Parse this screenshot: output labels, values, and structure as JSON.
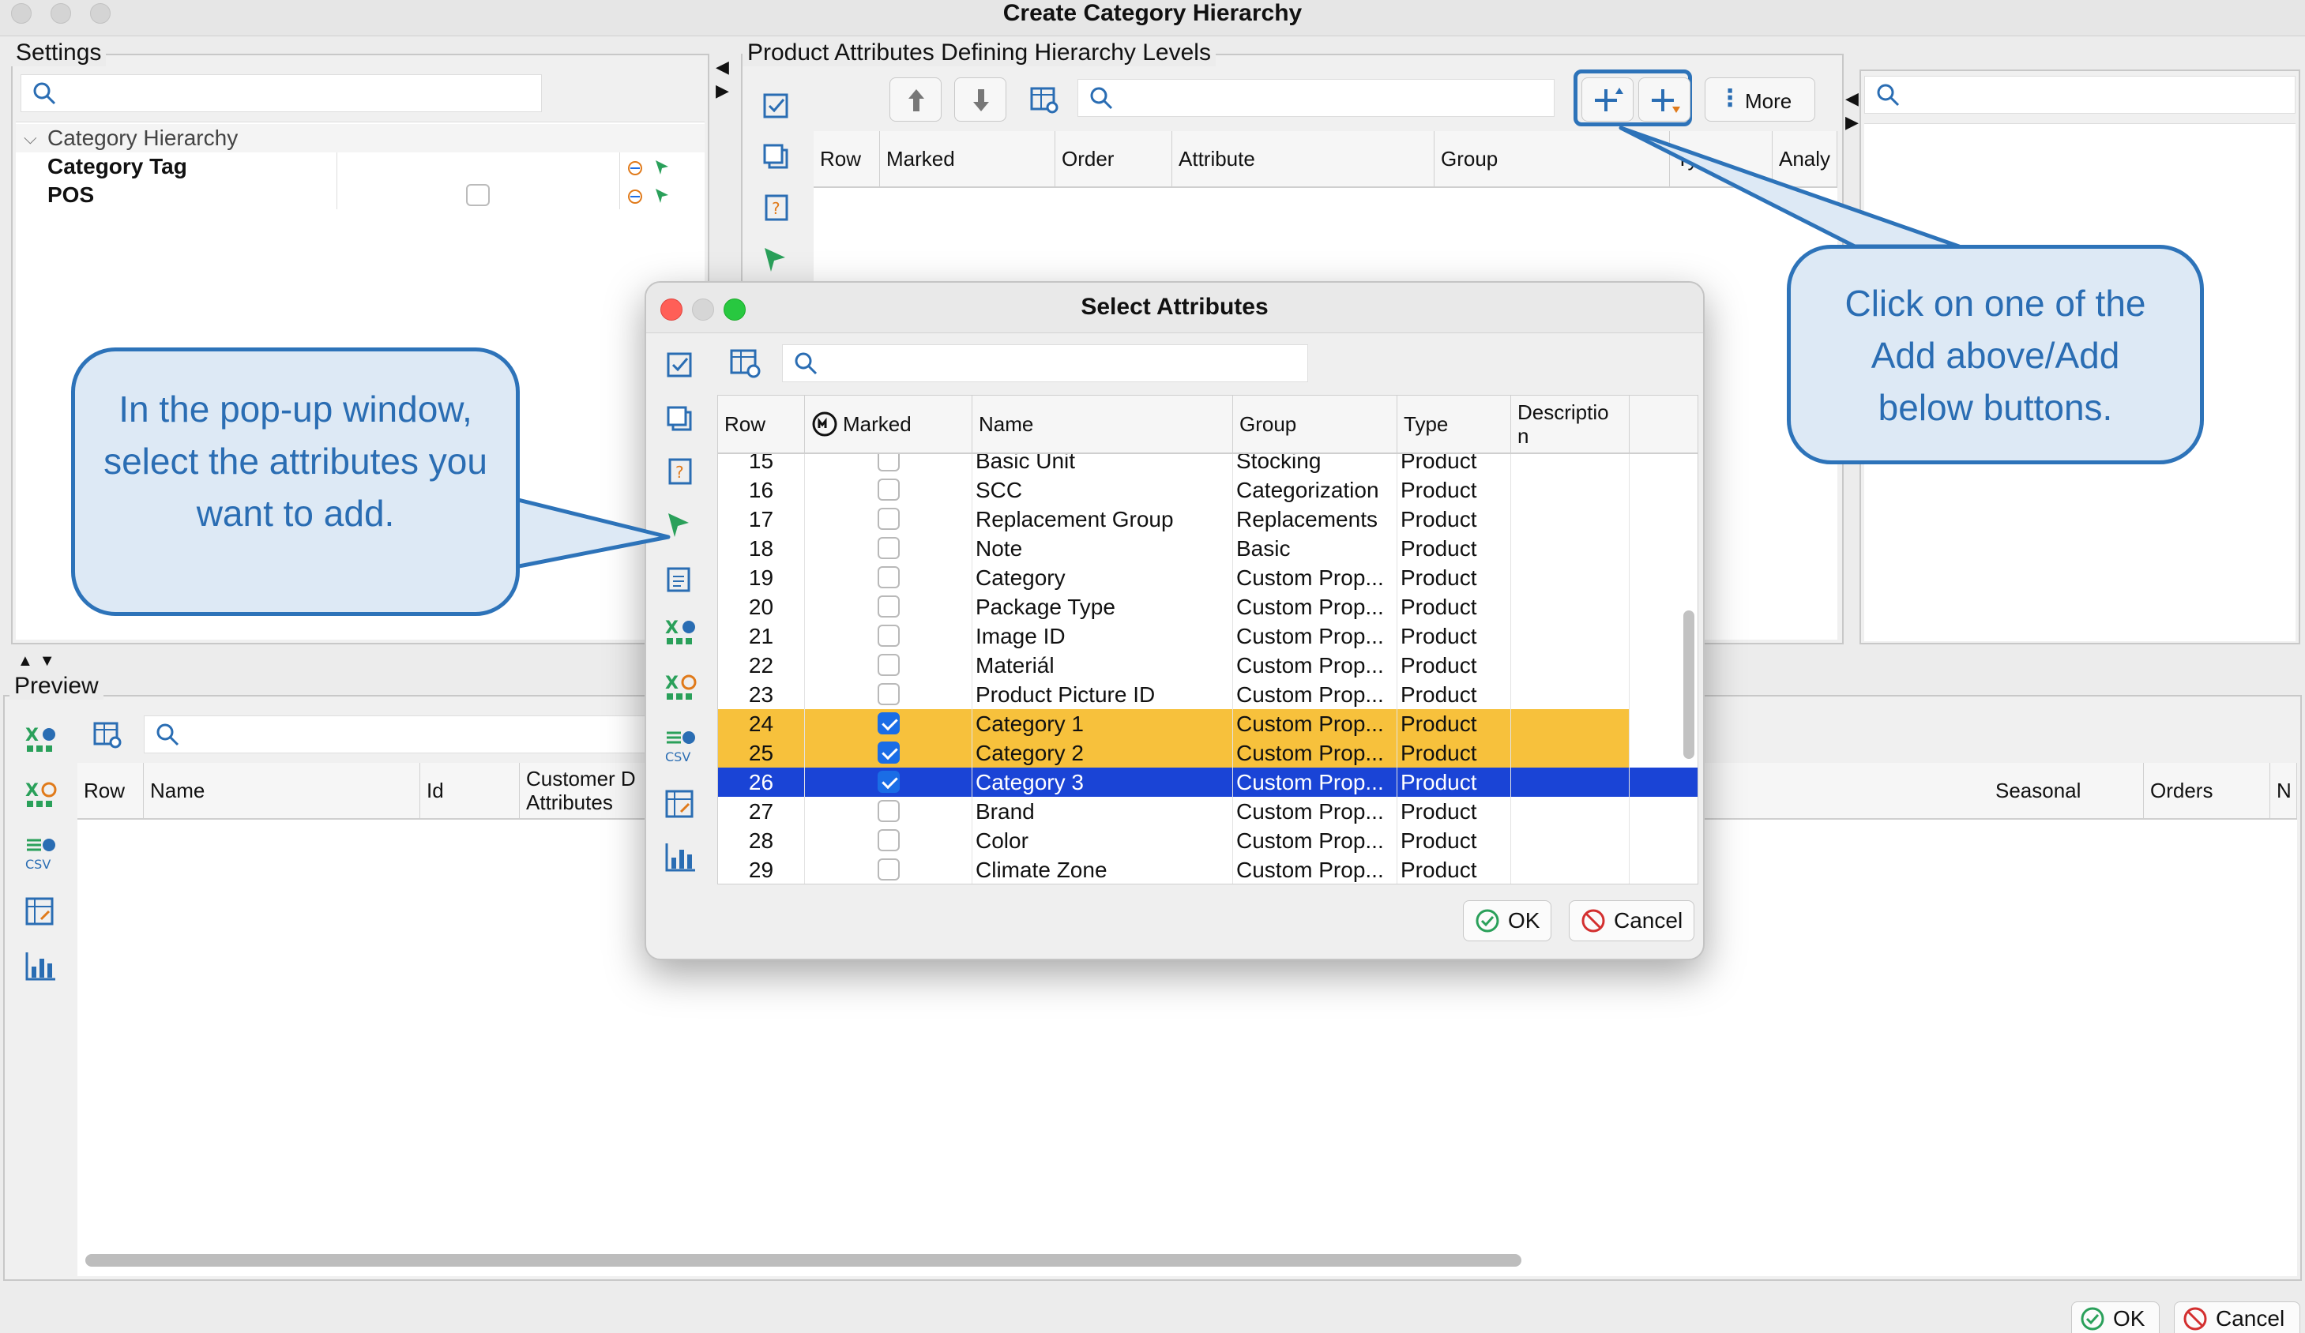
{
  "window": {
    "title": "Create Category Hierarchy"
  },
  "settings": {
    "label": "Settings",
    "tree": {
      "root": "Category Hierarchy",
      "items": [
        {
          "label": "Category Tag"
        },
        {
          "label": "POS"
        }
      ]
    }
  },
  "attributes_panel": {
    "label": "Product Attributes Defining Hierarchy Levels",
    "more_label": "More",
    "columns": [
      "Row",
      "Marked",
      "Order",
      "Attribute",
      "Group",
      "Ty",
      "Analy"
    ]
  },
  "preview": {
    "label": "Preview",
    "columns": [
      "Row",
      "Name",
      "Id",
      "Customer D",
      "Attributes",
      "Seasonal",
      "Orders",
      "N"
    ]
  },
  "dialog": {
    "title": "Select Attributes",
    "columns": [
      "Row",
      "Marked",
      "Name",
      "Group",
      "Type",
      "Descriptio",
      "n"
    ],
    "rows": [
      {
        "row": "15",
        "marked": false,
        "name": "Basic Unit",
        "group": "Stocking",
        "type": "Product",
        "state": "normal"
      },
      {
        "row": "16",
        "marked": false,
        "name": "SCC",
        "group": "Categorization",
        "type": "Product",
        "state": "normal"
      },
      {
        "row": "17",
        "marked": false,
        "name": "Replacement Group",
        "group": "Replacements",
        "type": "Product",
        "state": "normal"
      },
      {
        "row": "18",
        "marked": false,
        "name": "Note",
        "group": "Basic",
        "type": "Product",
        "state": "normal"
      },
      {
        "row": "19",
        "marked": false,
        "name": "Category",
        "group": "Custom Prop...",
        "type": "Product",
        "state": "normal"
      },
      {
        "row": "20",
        "marked": false,
        "name": "Package Type",
        "group": "Custom Prop...",
        "type": "Product",
        "state": "normal"
      },
      {
        "row": "21",
        "marked": false,
        "name": "Image ID",
        "group": "Custom Prop...",
        "type": "Product",
        "state": "normal"
      },
      {
        "row": "22",
        "marked": false,
        "name": "Materiál",
        "group": "Custom Prop...",
        "type": "Product",
        "state": "normal"
      },
      {
        "row": "23",
        "marked": false,
        "name": "Product Picture ID",
        "group": "Custom Prop...",
        "type": "Product",
        "state": "normal"
      },
      {
        "row": "24",
        "marked": true,
        "name": "Category 1",
        "group": "Custom Prop...",
        "type": "Product",
        "state": "marked"
      },
      {
        "row": "25",
        "marked": true,
        "name": "Category 2",
        "group": "Custom Prop...",
        "type": "Product",
        "state": "marked"
      },
      {
        "row": "26",
        "marked": true,
        "name": "Category 3",
        "group": "Custom Prop...",
        "type": "Product",
        "state": "selected"
      },
      {
        "row": "27",
        "marked": false,
        "name": "Brand",
        "group": "Custom Prop...",
        "type": "Product",
        "state": "normal"
      },
      {
        "row": "28",
        "marked": false,
        "name": "Color",
        "group": "Custom Prop...",
        "type": "Product",
        "state": "normal"
      },
      {
        "row": "29",
        "marked": false,
        "name": "Climate Zone",
        "group": "Custom Prop...",
        "type": "Product",
        "state": "normal"
      }
    ],
    "ok_label": "OK",
    "cancel_label": "Cancel"
  },
  "footer": {
    "ok_label": "OK",
    "cancel_label": "Cancel"
  },
  "callouts": {
    "left": "In the pop-up window, select the attributes you want to add.",
    "right": "Click on one of the Add above/Add below buttons."
  },
  "colors": {
    "marked_row": "#f7c13c",
    "selected_row": "#1a44d6",
    "accent": "#2d73b9",
    "callout_fill": "#dde9f5"
  },
  "icons": [
    "search-icon",
    "check-all-icon",
    "copy-icon",
    "help-icon",
    "cursor-icon",
    "arrow-up-icon",
    "arrow-down-icon",
    "table-settings-icon",
    "add-above-icon",
    "add-below-icon",
    "more-icon",
    "excel-icon",
    "csv-icon",
    "chart-icon",
    "ok-icon",
    "cancel-icon"
  ]
}
